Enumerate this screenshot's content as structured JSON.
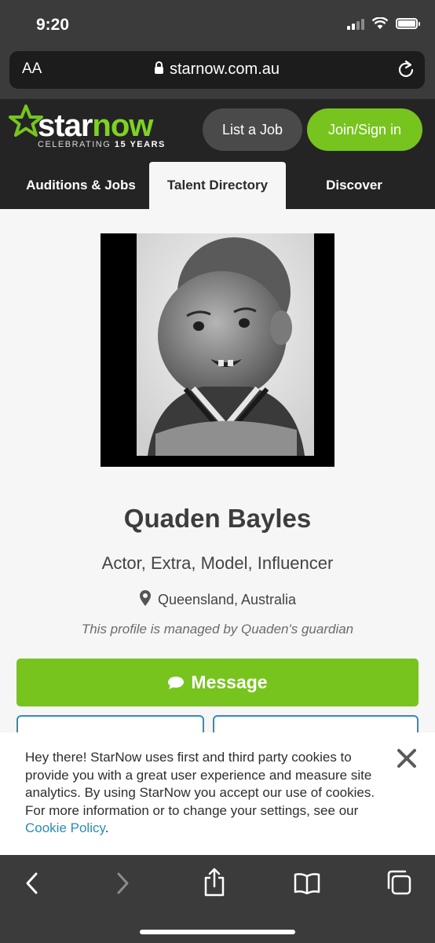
{
  "status_bar": {
    "time": "9:20"
  },
  "browser": {
    "text_size_label": "AA",
    "url": "starnow.com.au"
  },
  "site": {
    "logo_star": "star",
    "logo_now": "now",
    "tagline_prefix": "CELEBRATING",
    "tagline_years": "15 YEARS",
    "list_job": "List a Job",
    "join": "Join/Sign in",
    "nav": [
      {
        "label": "Auditions & Jobs"
      },
      {
        "label": "Talent Directory"
      },
      {
        "label": "Discover"
      }
    ]
  },
  "profile": {
    "name": "Quaden Bayles",
    "roles": "Actor, Extra, Model, Influencer",
    "location": "Queensland, Australia",
    "managed": "This profile is managed by Quaden's guardian",
    "message_button": "Message"
  },
  "cookie": {
    "text": "Hey there! StarNow uses first and third party cookies to provide you with a great user experience and measure site analytics. By using StarNow you accept our use of cookies. For more information or to change your settings, see our ",
    "link": "Cookie Policy",
    "end": "."
  },
  "icons": {
    "brand_green": "#77c41f",
    "accent_blue": "#2a8cb5"
  }
}
